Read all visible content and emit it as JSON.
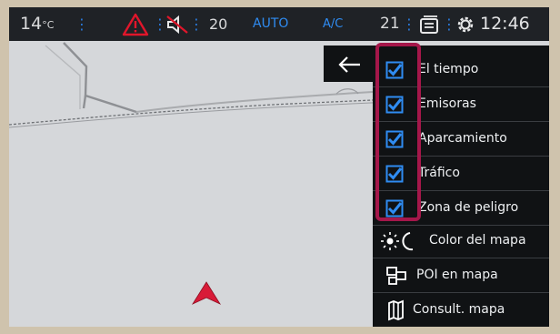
{
  "status": {
    "temp_left": "14",
    "temp_unit": "°C",
    "fan_speed": "20",
    "auto_label": "AUTO",
    "ac_label": "A/C",
    "temp_right": "21",
    "clock": "12:46"
  },
  "menu": {
    "back_icon": "arrow-left-icon",
    "layers": [
      {
        "label": "El tiempo",
        "checked": true
      },
      {
        "label": "Emisoras",
        "checked": true
      },
      {
        "label": "Aparcamiento",
        "checked": true
      },
      {
        "label": "Tráfico",
        "checked": true
      },
      {
        "label": "Zona de peligro",
        "checked": true
      }
    ],
    "actions": [
      {
        "label": "Color del mapa",
        "icon": "day-night-icon"
      },
      {
        "label": "POI en mapa",
        "icon": "poi-icon"
      },
      {
        "label": "Consult. mapa",
        "icon": "map-book-icon"
      }
    ]
  },
  "colors": {
    "accent_blue": "#2f8cf2",
    "highlight": "#a5174a",
    "panel": "#101214",
    "warning_red": "#e0162b",
    "vehicle_red": "#d81b38"
  }
}
